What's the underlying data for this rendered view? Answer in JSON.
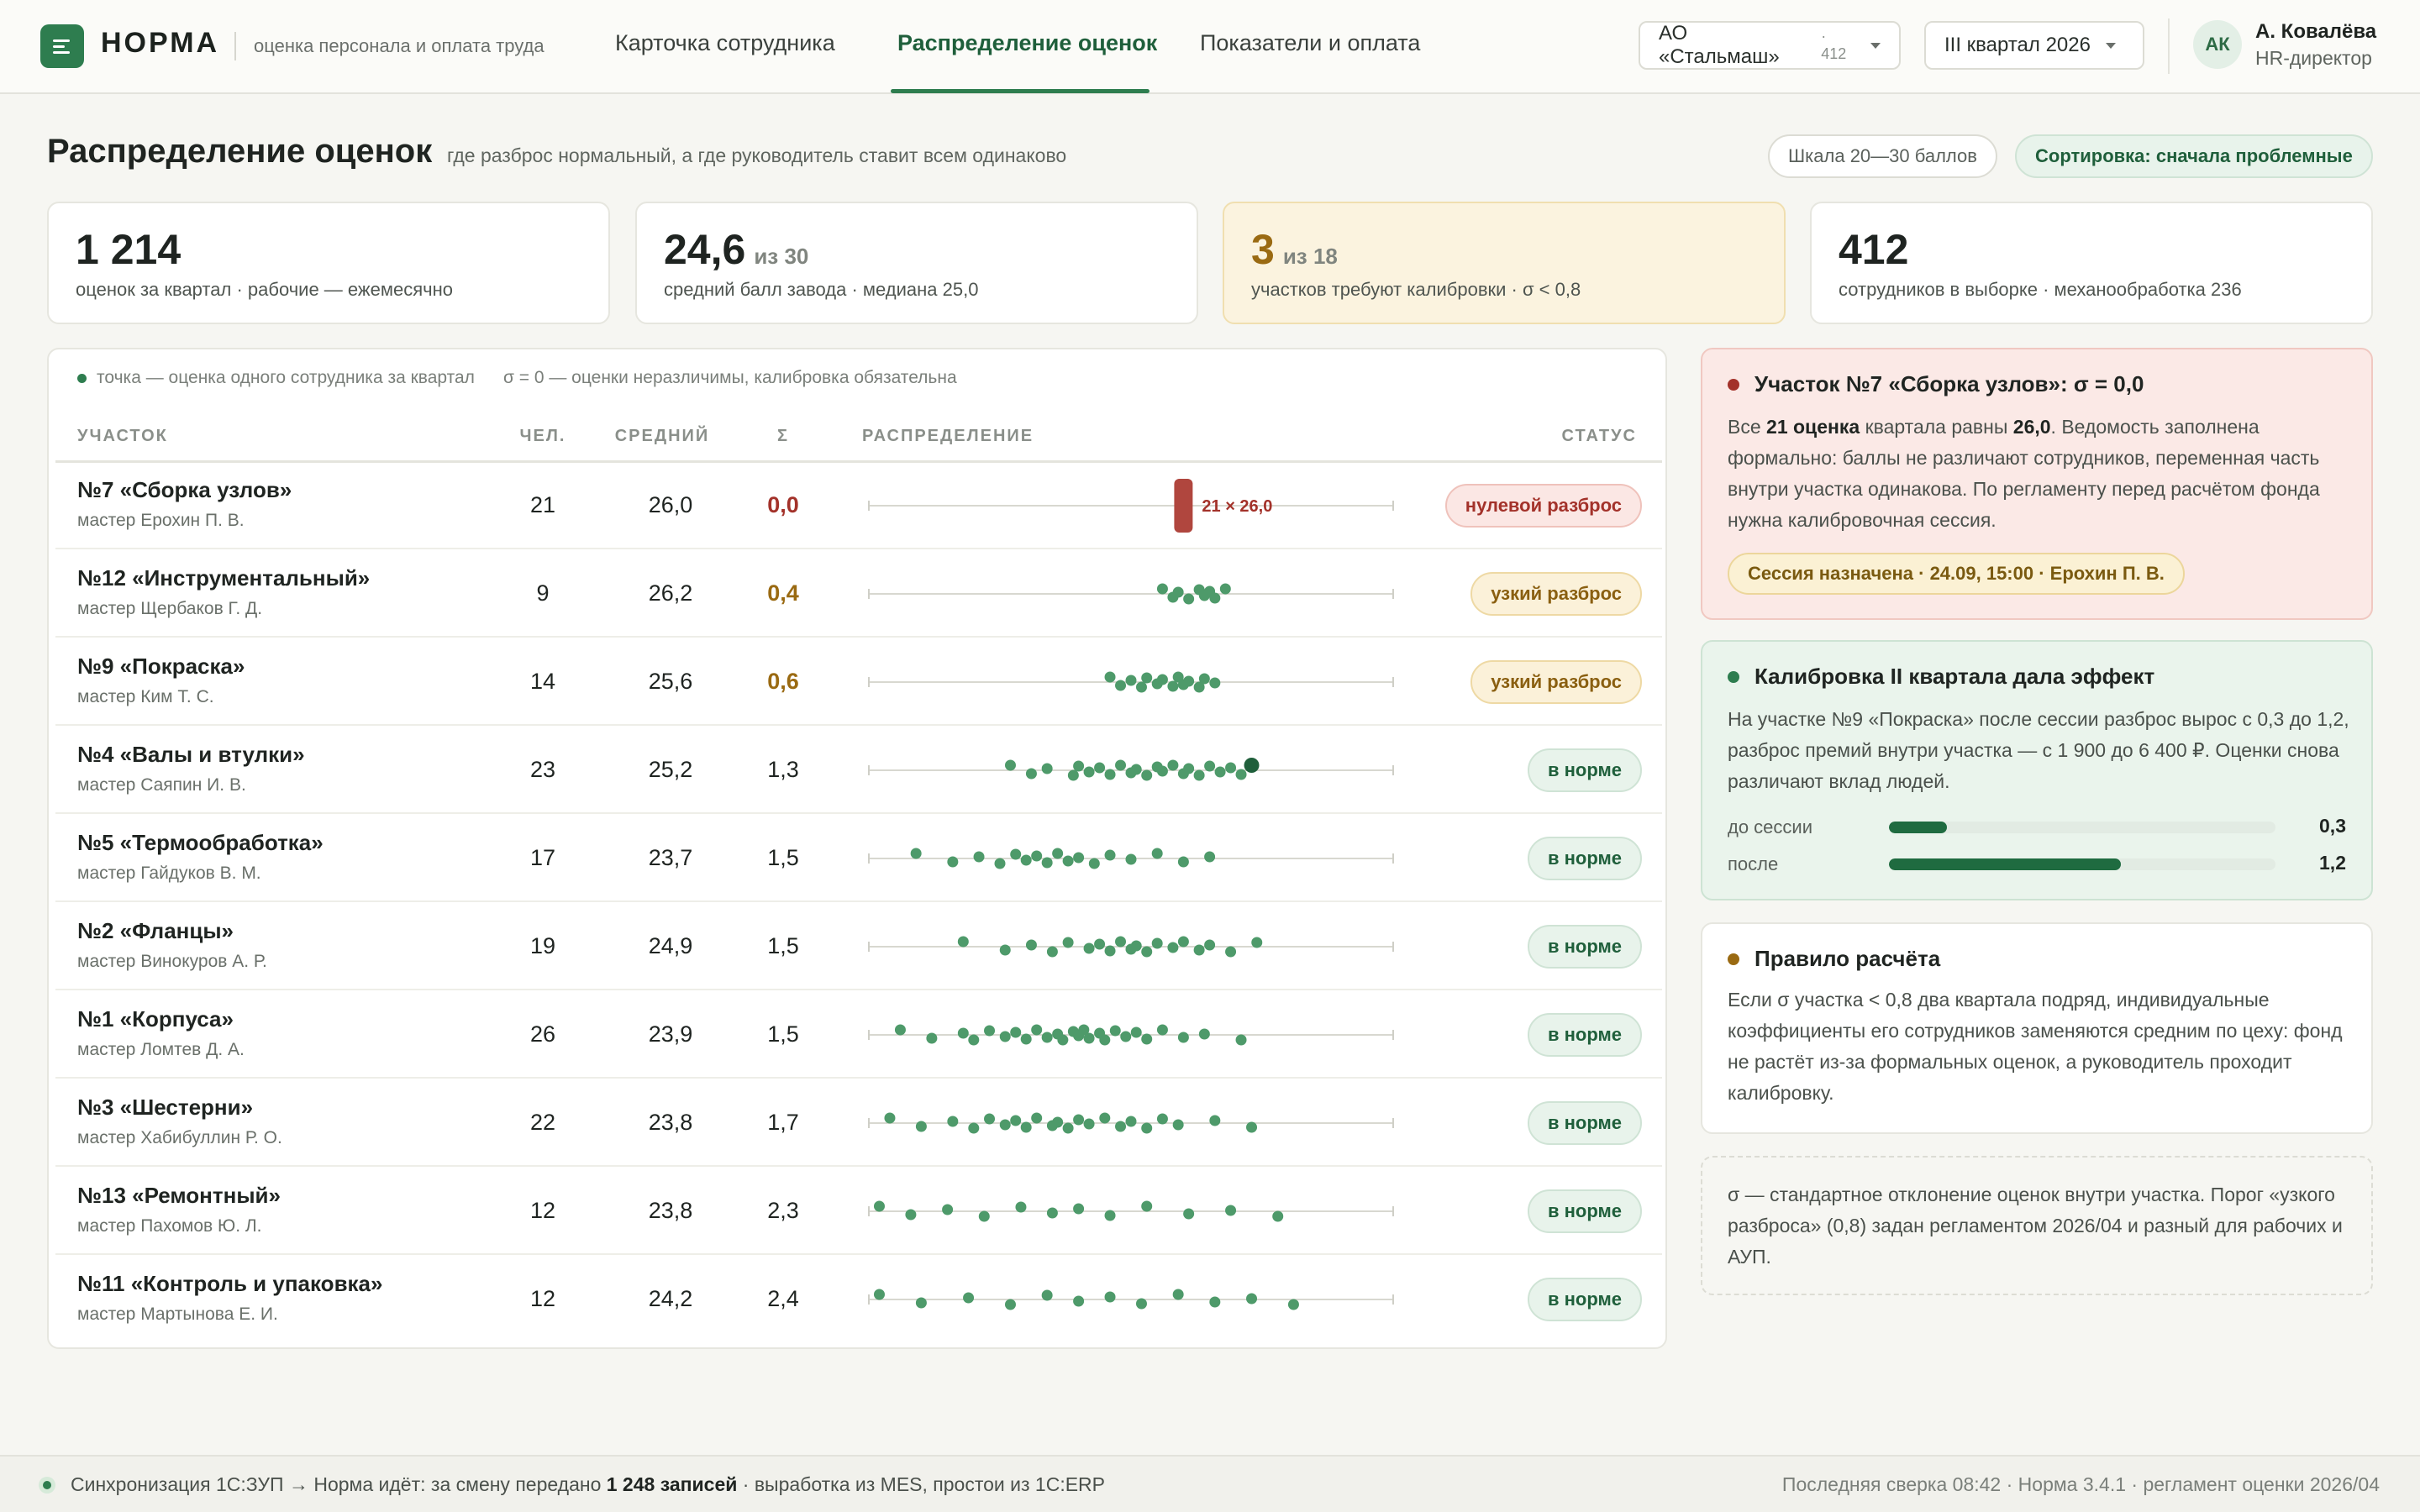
{
  "brand": {
    "name": "НОРМА",
    "subtitle": "оценка персонала и оплата труда"
  },
  "nav": {
    "tabs": [
      {
        "label": "Карточка сотрудника"
      },
      {
        "label": "Распределение оценок"
      },
      {
        "label": "Показатели и оплата"
      }
    ],
    "active_tab": "Распределение оценок"
  },
  "filters": {
    "company": {
      "value": "АО «Стальмаш»",
      "count": "· 412"
    },
    "period": {
      "value": "III квартал 2026"
    }
  },
  "user": {
    "initials": "АК",
    "name": "А. Ковалёва",
    "role": "HR-директор"
  },
  "page": {
    "title": "Распределение оценок",
    "subtitle": "где разброс нормальный, а где руководитель ставит всем одинаково",
    "scale_pill": "Шкала 20—30 баллов",
    "sort_pill": "Сортировка: сначала проблемные"
  },
  "kpis": [
    {
      "value": "1 214",
      "of": "",
      "label": "оценок за квартал · рабочие — ежемесячно"
    },
    {
      "value": "24,6",
      "of": "из 30",
      "label": "средний балл завода · медиана 25,0"
    },
    {
      "value": "3",
      "of": "из 18",
      "label": "участков требуют калибровки · σ < 0,8"
    },
    {
      "value": "412",
      "of": "",
      "label": "сотрудников в выборке · механообработка 236"
    }
  ],
  "table": {
    "legend_dot": "точка — оценка одного сотрудника за квартал",
    "legend_sigma": "σ = 0 — оценки неразличимы, калибровка обязательна",
    "headers": {
      "section": "УЧАСТОК",
      "people": "ЧЕЛ.",
      "mean": "СРЕДНИЙ",
      "sigma": "Σ",
      "dist": "РАСПРЕДЕЛЕНИЕ",
      "status": "СТАТУС"
    },
    "scale": {
      "min": 20,
      "max": 30
    },
    "rows": [
      {
        "name": "№7 «Сборка узлов»",
        "master": "мастер Ерохин П. В.",
        "people": "21",
        "mean": "26,0",
        "sigma": "0,0",
        "level": "red",
        "status": "нулевой разброс",
        "stack_label": "21 × 26,0",
        "scores": [
          26.0
        ]
      },
      {
        "name": "№12 «Инструментальный»",
        "master": "мастер Щербаков Г. Д.",
        "people": "9",
        "mean": "26,2",
        "sigma": "0,4",
        "level": "amber",
        "status": "узкий разброс",
        "scores": [
          25.6,
          25.8,
          25.9,
          26.1,
          26.3,
          26.4,
          26.5,
          26.6,
          26.8
        ]
      },
      {
        "name": "№9 «Покраска»",
        "master": "мастер Ким Т. С.",
        "people": "14",
        "mean": "25,6",
        "sigma": "0,6",
        "level": "amber",
        "status": "узкий разброс",
        "scores": [
          24.6,
          24.8,
          25.0,
          25.2,
          25.3,
          25.5,
          25.6,
          25.8,
          25.9,
          26.0,
          26.1,
          26.3,
          26.4,
          26.6
        ]
      },
      {
        "name": "№4 «Валы и втулки»",
        "master": "мастер Саяпин И. В.",
        "people": "23",
        "mean": "25,2",
        "sigma": "1,3",
        "level": "norm",
        "status": "в норме",
        "scores": [
          22.7,
          23.1,
          23.4,
          23.9,
          24.0,
          24.2,
          24.4,
          24.6,
          24.8,
          25.0,
          25.1,
          25.3,
          25.5,
          25.6,
          25.8,
          26.0,
          26.1,
          26.3,
          26.5,
          26.7,
          26.9,
          27.1,
          27.3
        ]
      },
      {
        "name": "№5 «Термообработка»",
        "master": "мастер Гайдуков В. М.",
        "people": "17",
        "mean": "23,7",
        "sigma": "1,5",
        "level": "norm",
        "status": "в норме",
        "scores": [
          20.9,
          21.6,
          22.1,
          22.5,
          22.8,
          23.0,
          23.2,
          23.4,
          23.6,
          23.8,
          24.0,
          24.3,
          24.6,
          25.0,
          25.5,
          26.0,
          26.5
        ]
      },
      {
        "name": "№2 «Фланцы»",
        "master": "мастер Винокуров А. Р.",
        "people": "19",
        "mean": "24,9",
        "sigma": "1,5",
        "level": "norm",
        "status": "в норме",
        "scores": [
          21.8,
          22.6,
          23.1,
          23.5,
          23.8,
          24.2,
          24.4,
          24.6,
          24.8,
          25.0,
          25.1,
          25.3,
          25.5,
          25.8,
          26.0,
          26.3,
          26.5,
          26.9,
          27.4
        ]
      },
      {
        "name": "№1 «Корпуса»",
        "master": "мастер Ломтев Д. А.",
        "people": "26",
        "mean": "23,9",
        "sigma": "1,5",
        "level": "norm",
        "status": "в норме",
        "scores": [
          20.6,
          21.2,
          21.8,
          22.0,
          22.3,
          22.6,
          22.8,
          23.0,
          23.2,
          23.4,
          23.6,
          23.7,
          23.9,
          24.0,
          24.1,
          24.2,
          24.4,
          24.5,
          24.7,
          24.9,
          25.1,
          25.3,
          25.6,
          26.0,
          26.4,
          27.1
        ]
      },
      {
        "name": "№3 «Шестерни»",
        "master": "мастер Хабибуллин Р. О.",
        "people": "22",
        "mean": "23,8",
        "sigma": "1,7",
        "level": "norm",
        "status": "в норме",
        "scores": [
          20.4,
          21.0,
          21.6,
          22.0,
          22.3,
          22.6,
          22.8,
          23.0,
          23.2,
          23.5,
          23.6,
          23.8,
          24.0,
          24.2,
          24.5,
          24.8,
          25.0,
          25.3,
          25.6,
          25.9,
          26.6,
          27.3
        ]
      },
      {
        "name": "№13 «Ремонтный»",
        "master": "мастер Пахомов Ю. Л.",
        "people": "12",
        "mean": "23,8",
        "sigma": "2,3",
        "level": "norm",
        "status": "в норме",
        "scores": [
          20.2,
          20.8,
          21.5,
          22.2,
          22.9,
          23.5,
          24.0,
          24.6,
          25.3,
          26.1,
          26.9,
          27.8
        ]
      },
      {
        "name": "№11 «Контроль и упаковка»",
        "master": "мастер Мартынова Е. И.",
        "people": "12",
        "mean": "24,2",
        "sigma": "2,4",
        "level": "norm",
        "status": "в норме",
        "scores": [
          20.2,
          21.0,
          21.9,
          22.7,
          23.4,
          24.0,
          24.6,
          25.2,
          25.9,
          26.6,
          27.3,
          28.1
        ]
      }
    ],
    "colors": {
      "red": "#b0463e",
      "dot": "#4e9a6a",
      "dot_highlight": "#1f5f3b"
    }
  },
  "side": {
    "alert": {
      "title": "Участок №7 «Сборка узлов»: σ = 0,0",
      "text_prefix": "Все ",
      "text_count": "21 оценка",
      "text_mid": " квартала равны ",
      "text_value": "26,0",
      "text_suffix": ". Ведомость заполнена формально: баллы не различают сотрудников, переменная часть внутри участка одинакова. По регламенту перед расчётом фонда нужна калибровочная сессия.",
      "session": "Сессия назначена · 24.09, 15:00 · Ерохин П. В."
    },
    "effect": {
      "title": "Калибровка II квартала дала эффект",
      "text": "На участке №9 «Покраска» после сессии разброс вырос с 0,3 до 1,2, разброс премий внутри участка — с 1 900 до 6 400 ₽. Оценки снова различают вклад людей.",
      "bars": [
        {
          "label": "до сессии",
          "value": "0,3",
          "fill_fraction": 0.15
        },
        {
          "label": "после",
          "value": "1,2",
          "fill_fraction": 0.6
        }
      ]
    },
    "rule": {
      "title": "Правило расчёта",
      "text": "Если σ участка < 0,8 два квартала подряд, индивидуальные коэффициенты его сотрудников заменяются средним по цеху: фонд не растёт из-за формальных оценок, а руководитель проходит калибровку."
    },
    "note": {
      "text": "σ — стандартное отклонение оценок внутри участка. Порог «узкого разброса» (0,8) задан регламентом 2026/04 и разный для рабочих и АУП."
    }
  },
  "footer": {
    "sync_prefix": "Синхронизация 1С:ЗУП → Норма идёт: за смену передано ",
    "sync_count": "1 248 записей",
    "sync_suffix": " · выработка из MES, простои из 1С:ERP",
    "right": "Последняя сверка 08:42 · Норма 3.4.1 · регламент оценки 2026/04"
  }
}
